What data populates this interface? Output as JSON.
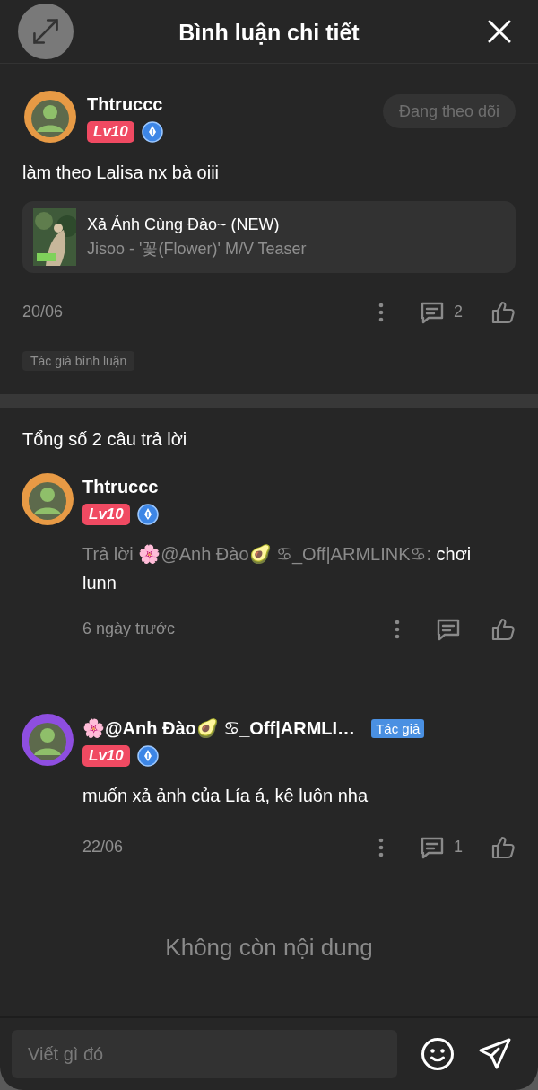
{
  "header": {
    "title": "Bình luận chi tiết"
  },
  "comment": {
    "author": "Thtruccc",
    "avatar": {
      "color": "#e79a45"
    },
    "level": "Lv10",
    "follow_button": "Đang theo dõi",
    "text": "làm theo Lalisa nx bà oiii",
    "attachment": {
      "title": "Xả Ảnh Cùng Đào~ (NEW)",
      "subtitle": "Jisoo - '꽃(Flower)' M/V Teaser"
    },
    "date": "20/06",
    "reply_count": "2",
    "tag": "Tác giả bình luận"
  },
  "replies_heading": "Tổng số 2 câu trả lời",
  "replies": [
    {
      "author": "Thtruccc",
      "avatar": {
        "color": "#e79a45"
      },
      "level": "Lv10",
      "reply_to": "Trả lời 🌸@Anh Đào🥑 ♋_Off|ARMLINK♋: ",
      "text": "chơi lunn",
      "date": "6 ngày trước"
    },
    {
      "author": "🌸@Anh Đào🥑 ♋_Off|ARMLI…",
      "avatar": {
        "color": "#8e4ee0"
      },
      "author_badge": "Tác giả",
      "level": "Lv10",
      "text": "muốn xả ảnh của Lía á, kê luôn nha",
      "date": "22/06",
      "reply_count": "1"
    }
  ],
  "end_text": "Không còn nội dung",
  "composer": {
    "placeholder": "Viết gì đó"
  }
}
